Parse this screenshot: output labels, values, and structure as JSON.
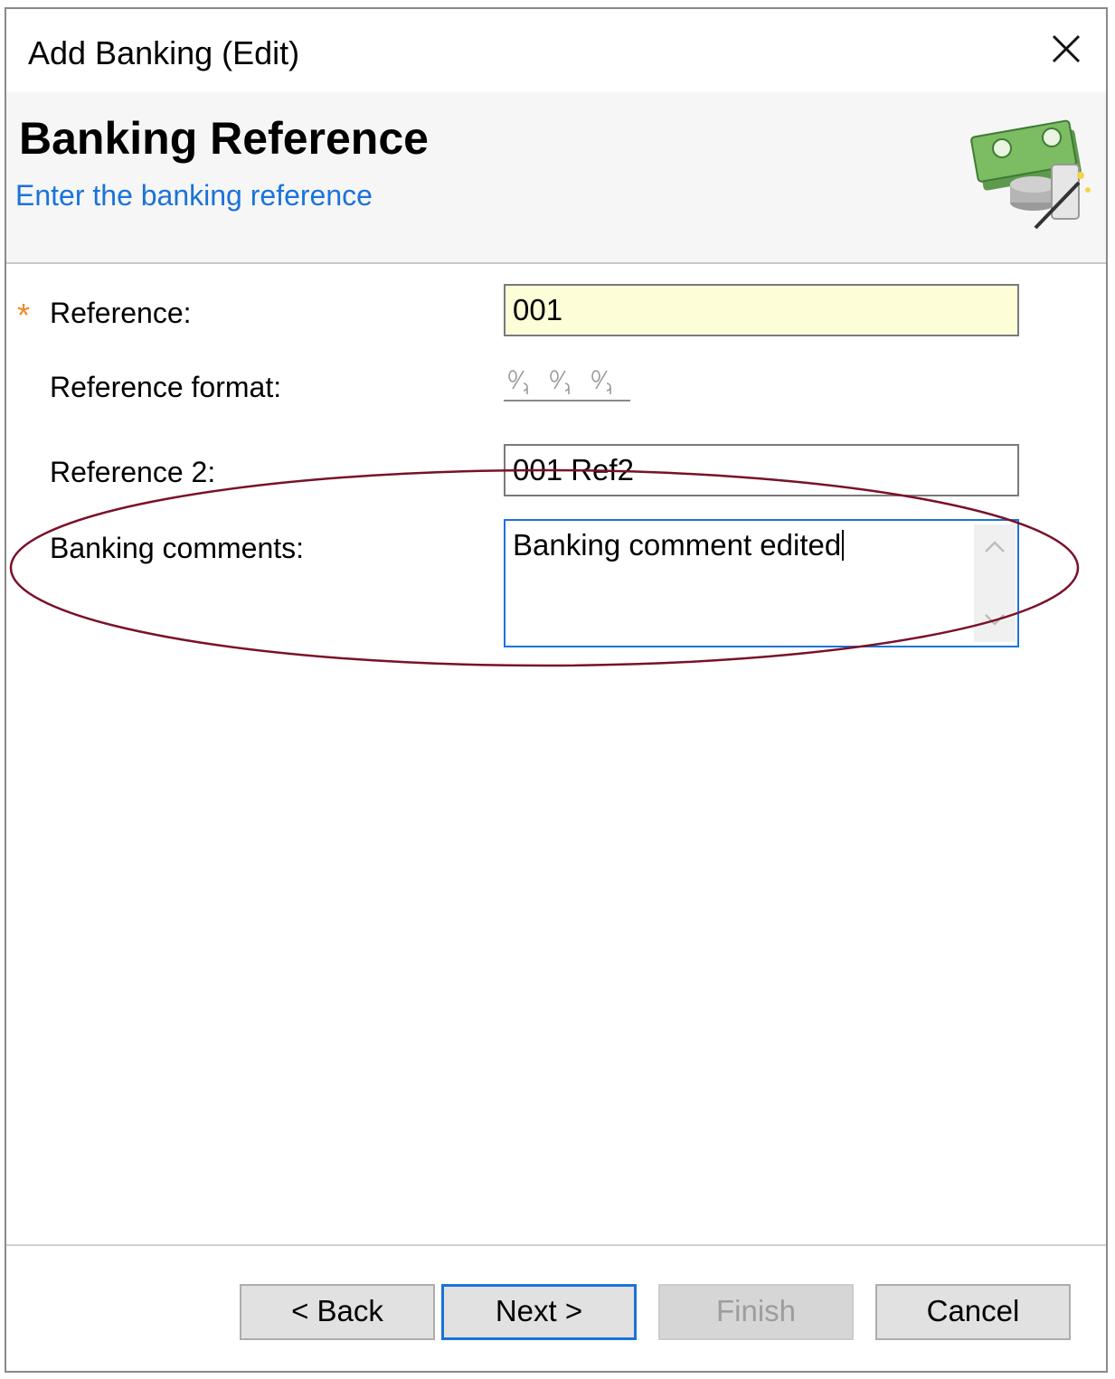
{
  "window": {
    "title": "Add Banking (Edit)"
  },
  "header": {
    "title": "Banking Reference",
    "subtitle": "Enter the banking reference"
  },
  "form": {
    "required_marker": "*",
    "reference_label": "Reference:",
    "reference_value": "001",
    "reference_format_label": "Reference format:",
    "reference2_label": "Reference 2:",
    "reference2_value": "001 Ref2",
    "comments_label": "Banking comments:",
    "comments_value": "Banking comment edited"
  },
  "buttons": {
    "back": "< Back",
    "next": "Next >",
    "finish": "Finish",
    "cancel": "Cancel"
  },
  "colors": {
    "accent": "#1a73d9",
    "required": "#f08a24",
    "annotation": "#7a1128",
    "required_field_bg": "#fdfdd8"
  }
}
